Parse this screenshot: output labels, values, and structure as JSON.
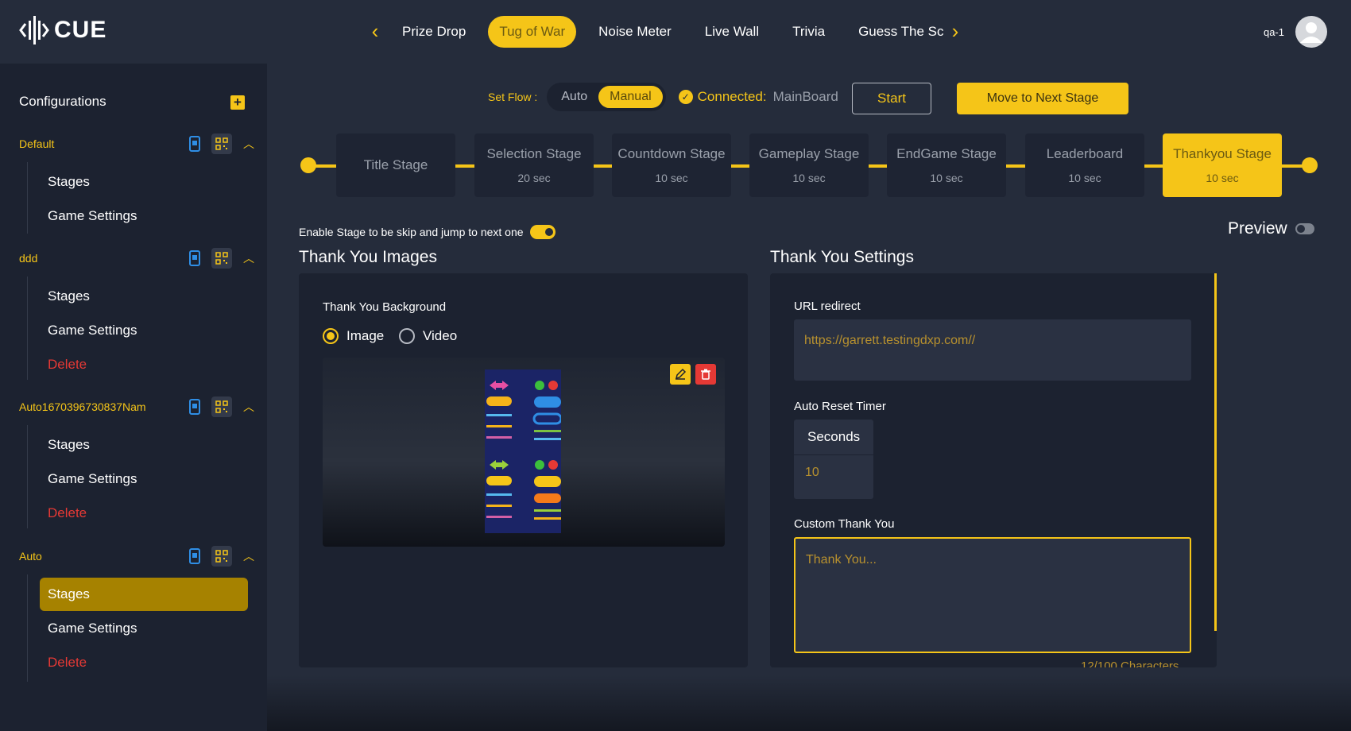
{
  "app": {
    "logo_text": "CUE",
    "user_name": "qa-1"
  },
  "nav": {
    "tabs": [
      {
        "label": "Prize Drop",
        "active": false
      },
      {
        "label": "Tug of War",
        "active": true
      },
      {
        "label": "Noise Meter",
        "active": false
      },
      {
        "label": "Live Wall",
        "active": false
      },
      {
        "label": "Trivia",
        "active": false
      },
      {
        "label": "Guess The Sc",
        "active": false
      }
    ]
  },
  "sidebar": {
    "title": "Configurations",
    "groups": [
      {
        "name": "Default",
        "items": [
          "Stages",
          "Game Settings"
        ]
      },
      {
        "name": "ddd",
        "items": [
          "Stages",
          "Game Settings",
          "Delete"
        ]
      },
      {
        "name": "Auto1670396730837Nam",
        "items": [
          "Stages",
          "Game Settings",
          "Delete"
        ]
      },
      {
        "name": "Auto",
        "items": [
          "Stages",
          "Game Settings",
          "Delete"
        ],
        "active_item": "Stages"
      }
    ]
  },
  "flow": {
    "label": "Set Flow :",
    "options": [
      "Auto",
      "Manual"
    ],
    "selected": "Manual",
    "connected_label": "Connected:",
    "connected_value": "MainBoard",
    "start_label": "Start",
    "next_stage_label": "Move to Next Stage"
  },
  "stages": [
    {
      "name": "Title Stage",
      "time": ""
    },
    {
      "name": "Selection Stage",
      "time": "20 sec"
    },
    {
      "name": "Countdown Stage",
      "time": "10 sec"
    },
    {
      "name": "Gameplay Stage",
      "time": "10 sec"
    },
    {
      "name": "EndGame Stage",
      "time": "10 sec"
    },
    {
      "name": "Leaderboard",
      "time": "10 sec"
    },
    {
      "name": "Thankyou Stage",
      "time": "10 sec",
      "active": true
    }
  ],
  "enable_skip_label": "Enable Stage to be skip and jump to next one",
  "preview_label": "Preview",
  "images": {
    "title": "Thank You Images",
    "background_label": "Thank You Background",
    "options": [
      "Image",
      "Video"
    ],
    "selected": "Image"
  },
  "settings": {
    "title": "Thank You Settings",
    "url_label": "URL redirect",
    "url_value": "https://garrett.testingdxp.com//",
    "timer_label": "Auto Reset Timer",
    "seconds_label": "Seconds",
    "seconds_value": "10",
    "custom_label": "Custom Thank You",
    "custom_value": "Thank You...",
    "char_count": "12/100 Characters"
  },
  "colors": {
    "accent": "#f5c518",
    "bg": "#252c3b",
    "panel": "#1c2230",
    "danger": "#e53935"
  }
}
